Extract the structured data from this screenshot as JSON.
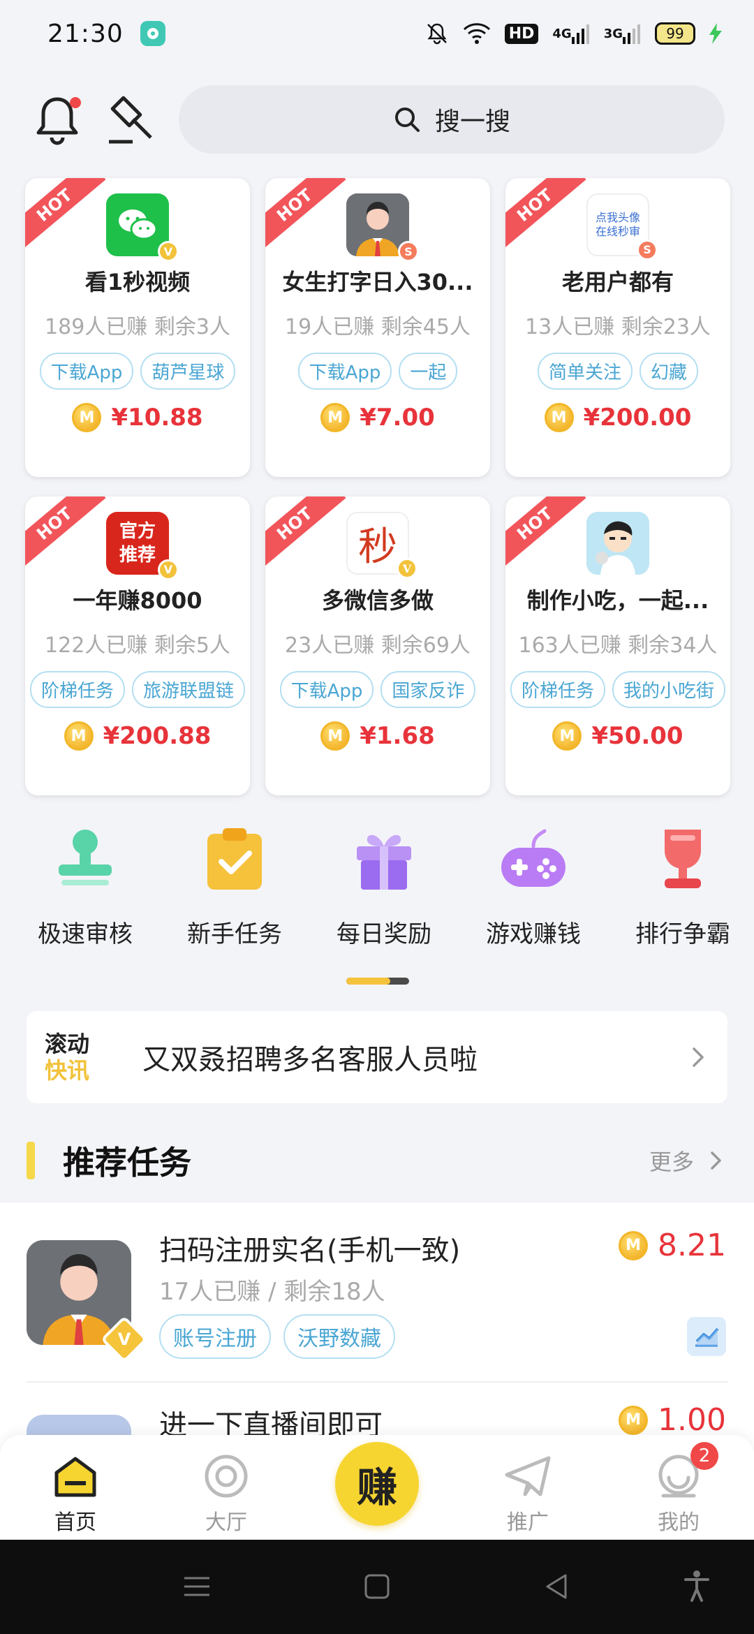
{
  "status_bar": {
    "time": "21:30",
    "battery": "99",
    "net1": "4G",
    "net2": "3G",
    "hd": "HD"
  },
  "header": {
    "search_placeholder": "搜一搜"
  },
  "cards": [
    {
      "hot": "HOT",
      "title": "看1秒视频",
      "stats": "189人已赚  剩余3人",
      "tags": [
        "下载App",
        "葫芦星球"
      ],
      "price": "¥10.88",
      "badge": "V"
    },
    {
      "hot": "HOT",
      "title": "女生打字日入30...",
      "stats": "19人已赚  剩余45人",
      "tags": [
        "下载App",
        "一起"
      ],
      "price": "¥7.00",
      "badge": "S"
    },
    {
      "hot": "HOT",
      "title": "老用户都有",
      "stats": "13人已赚  剩余23人",
      "tags": [
        "简单关注",
        "幻藏"
      ],
      "price": "¥200.00",
      "badge": "S",
      "logo_text": "点我头像 在线秒审"
    },
    {
      "hot": "HOT",
      "title": "一年赚8000",
      "stats": "122人已赚  剩余5人",
      "tags": [
        "阶梯任务",
        "旅游联盟链"
      ],
      "price": "¥200.88",
      "badge": "V",
      "logo_text": "官方 推荐"
    },
    {
      "hot": "HOT",
      "title": "多微信多做",
      "stats": "23人已赚  剩余69人",
      "tags": [
        "下载App",
        "国家反诈"
      ],
      "price": "¥1.68",
      "badge": "V",
      "logo_text": "秒"
    },
    {
      "hot": "HOT",
      "title": "制作小吃，一起...",
      "stats": "163人已赚  剩余34人",
      "tags": [
        "阶梯任务",
        "我的小吃街"
      ],
      "price": "¥50.00",
      "badge": ""
    }
  ],
  "coin_letter": "M",
  "categories": [
    {
      "label": "极速审核",
      "icon": "stamp-icon"
    },
    {
      "label": "新手任务",
      "icon": "clipboard-check-icon"
    },
    {
      "label": "每日奖励",
      "icon": "gift-icon"
    },
    {
      "label": "游戏赚钱",
      "icon": "gamepad-icon"
    },
    {
      "label": "排行争霸",
      "icon": "trophy-icon"
    }
  ],
  "category_scroll_progress": 0.7,
  "news": {
    "label_top": "滚动",
    "label_bottom": "快讯",
    "text": "又双叒招聘多名客服人员啦"
  },
  "section": {
    "title": "推荐任务",
    "more": "更多"
  },
  "tasks": [
    {
      "title": "扫码注册实名(手机一致)",
      "stats": "17人已赚   /   剩余18人",
      "tags": [
        "账号注册",
        "沃野数藏"
      ],
      "price": "8.21",
      "badge": "V"
    },
    {
      "title": "进一下直播间即可",
      "price": "1.00"
    }
  ],
  "bottom_nav": {
    "home": "首页",
    "hall": "大厅",
    "earn": "赚",
    "promote": "推广",
    "mine": "我的",
    "mine_badge": "2"
  },
  "colors": {
    "accent_yellow": "#f7d531",
    "price_red": "#e8333a",
    "hot_red": "#f1555a",
    "tag_blue": "#4aa6d3"
  }
}
